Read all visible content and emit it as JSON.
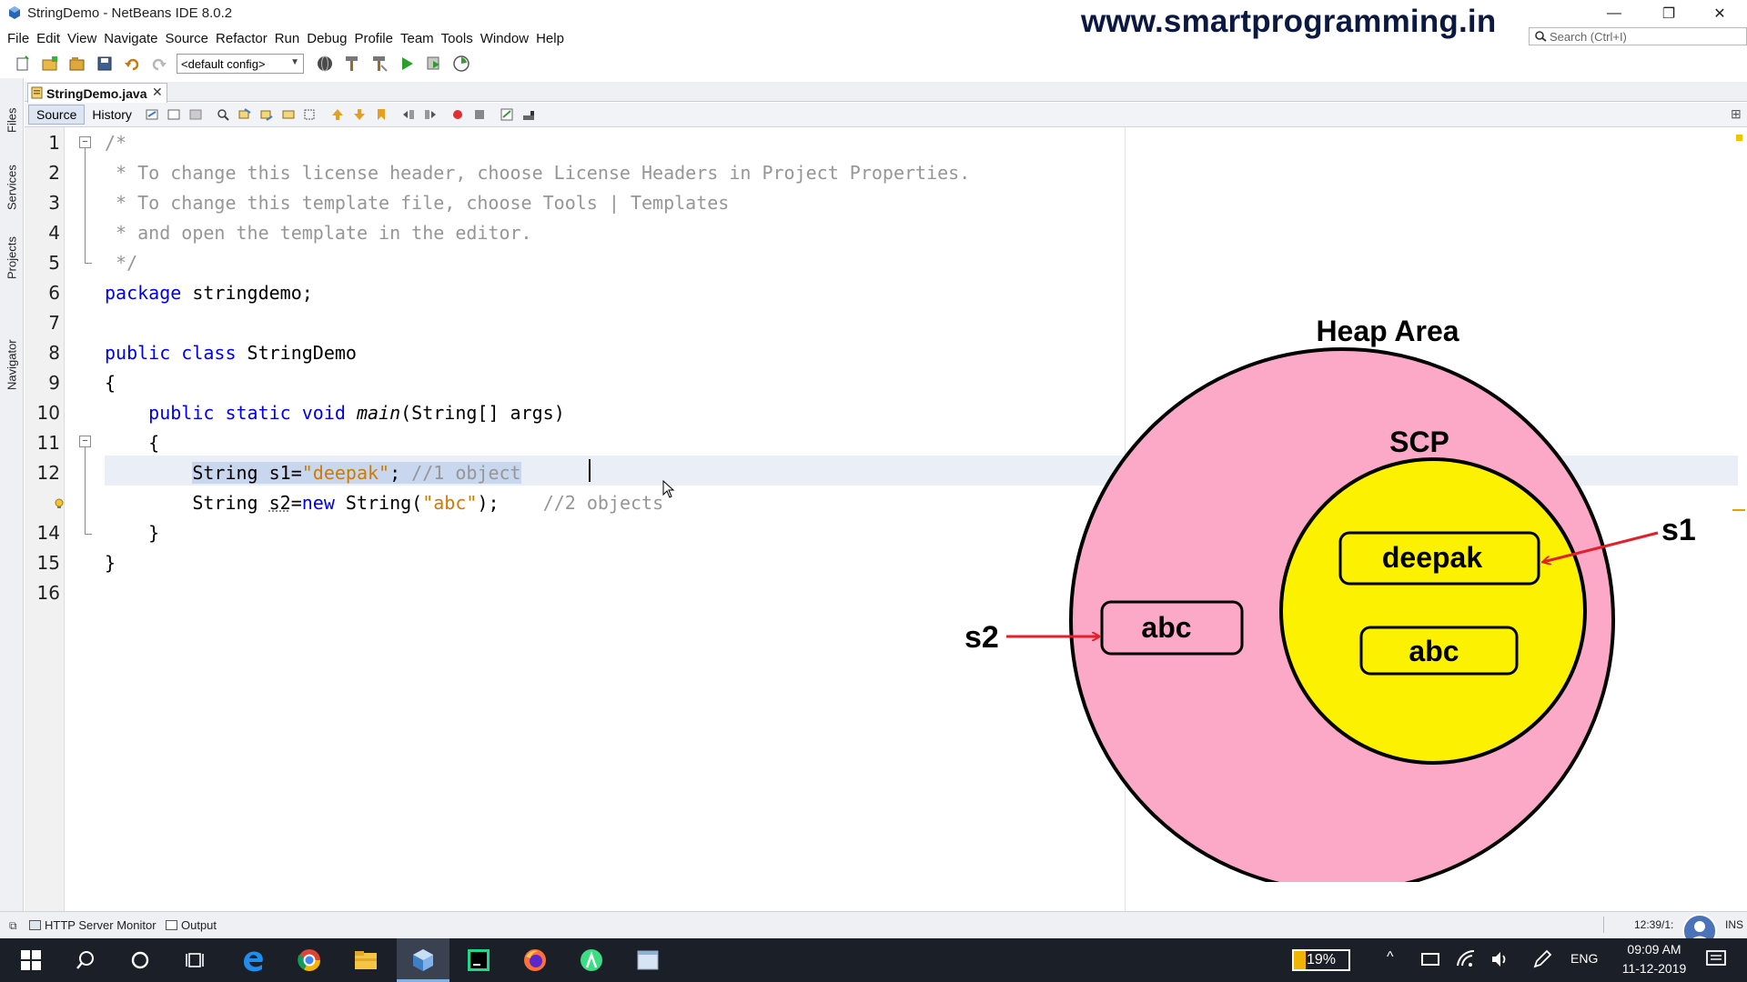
{
  "window": {
    "title": "StringDemo - NetBeans IDE 8.0.2",
    "watermark": "www.smartprogramming.in",
    "buttons": {
      "minimize": "—",
      "restore": "❐",
      "close": "✕"
    }
  },
  "menu": [
    "File",
    "Edit",
    "View",
    "Navigate",
    "Source",
    "Refactor",
    "Run",
    "Debug",
    "Profile",
    "Team",
    "Tools",
    "Window",
    "Help"
  ],
  "search": {
    "placeholder": "Search (Ctrl+I)"
  },
  "toolbar": {
    "config": "<default config>"
  },
  "side_tabs": [
    "Files",
    "Services",
    "Projects",
    "Navigator"
  ],
  "editor_tab": {
    "filename": "StringDemo.java",
    "close": "✕"
  },
  "editor_toolbar": {
    "source": "Source",
    "history": "History"
  },
  "code": {
    "line_numbers": [
      "1",
      "2",
      "3",
      "4",
      "5",
      "6",
      "7",
      "8",
      "9",
      "10",
      "11",
      "12",
      "",
      "14",
      "15",
      "16"
    ],
    "l1": "/*",
    "l2": " * To change this license header, choose License Headers in Project Properties.",
    "l3": " * To change this template file, choose Tools | Templates",
    "l4": " * and open the template in the editor.",
    "l5": " */",
    "l6_kw": "package",
    "l6_rest": " stringdemo;",
    "l8_kw": "public class",
    "l8_rest": " StringDemo",
    "l9": "{",
    "l10_indent": "    ",
    "l10_kw": "public static void",
    "l10_method": "main",
    "l10_rest": "(String[] args)",
    "l11": "    {",
    "l12_indent": "        ",
    "l12_a": "String s1=",
    "l12_str": "\"deepak\"",
    "l12_b": "; ",
    "l12_comment": "//1 object",
    "l13_indent": "        ",
    "l13_a": "String ",
    "l13_var": "s2",
    "l13_b": "=",
    "l13_kw": "new",
    "l13_c": " String(",
    "l13_str": "\"abc\"",
    "l13_d": ");    ",
    "l13_comment": "//2 objects",
    "l14": "    }",
    "l15": "}"
  },
  "diagram": {
    "heap_label": "Heap Area",
    "scp_label": "SCP",
    "scp_strings": [
      "deepak",
      "abc"
    ],
    "heap_string": "abc",
    "refs": [
      "s1",
      "s2"
    ],
    "colors": {
      "heap": "#fca9c8",
      "scp": "#fcf200",
      "arrow": "#e0202a"
    }
  },
  "status": {
    "http_monitor": "HTTP Server Monitor",
    "output": "Output",
    "position": "12:39/1:",
    "mode": "INS"
  },
  "tray": {
    "battery": "19%",
    "lang": "ENG",
    "time": "09:09 AM",
    "date": "11-12-2019"
  }
}
